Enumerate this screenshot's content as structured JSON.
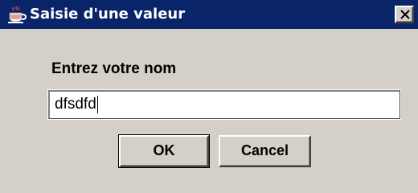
{
  "window": {
    "title": "Saisie d'une valeur",
    "app_icon": "java-cup-icon",
    "close_icon": "close-icon"
  },
  "dialog": {
    "prompt": "Entrez votre nom",
    "input_value": "dfsdfd",
    "ok_label": "OK",
    "cancel_label": "Cancel"
  },
  "colors": {
    "titlebar": "#0a246a",
    "face": "#d4d0c8"
  }
}
